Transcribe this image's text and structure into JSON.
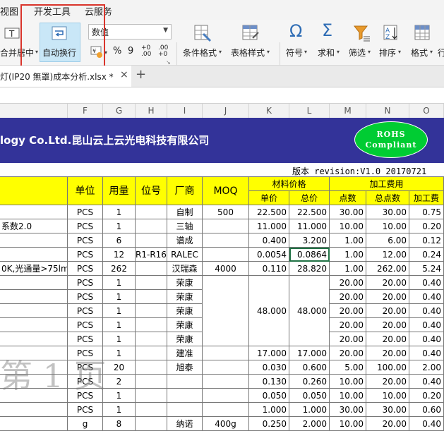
{
  "menubar": {
    "view": "视图",
    "developer": "开发工具",
    "cloud": "云服务"
  },
  "ribbon": {
    "merge_center": "合并居中",
    "wrap_text": "自动换行",
    "number_format": "数值",
    "percent": "%",
    "comma": "9",
    "inc_decimal": "+0 .00",
    "dec_decimal": ".00 +0",
    "conditional_format": "条件格式",
    "table_style": "表格样式",
    "symbol": "符号",
    "sum": "求和",
    "filter": "筛选",
    "sort": "排序",
    "format": "格式",
    "more": "行"
  },
  "tab": {
    "filename": "灯(IP20 無罩)成本分析.xlsx *",
    "close": "×",
    "add": "+"
  },
  "columns": [
    "F",
    "G",
    "H",
    "I",
    "J",
    "K",
    "L",
    "M",
    "N",
    "O"
  ],
  "banner": {
    "company": "logy Co.Ltd.昆山云上云光电科技有限公司",
    "rohs_line1": "ROHS",
    "rohs_line2": "Compliant"
  },
  "version": "版本 revision:V1.0 20170721",
  "headers": {
    "unit": "单位",
    "qty": "用量",
    "position": "位号",
    "maker": "厂商",
    "moq": "MOQ",
    "material_price": "材料价格",
    "unit_price": "单价",
    "total_price": "总价",
    "processing_fee": "加工费用",
    "points": "点数",
    "total_points": "总点数",
    "processing": "加工费"
  },
  "rows": [
    {
      "desc": "",
      "unit": "PCS",
      "qty": "1",
      "pos": "",
      "maker": "自制",
      "moq": "500",
      "up": "22.500",
      "tp": "22.500",
      "pts": "30.00",
      "tpts": "30.00",
      "fee": "0.75"
    },
    {
      "desc": "系数2.0",
      "unit": "PCS",
      "qty": "1",
      "pos": "",
      "maker": "三轴",
      "moq": "",
      "up": "11.000",
      "tp": "11.000",
      "pts": "10.00",
      "tpts": "10.00",
      "fee": "0.20"
    },
    {
      "desc": "",
      "unit": "PCS",
      "qty": "6",
      "pos": "",
      "maker": "谱成",
      "moq": "",
      "up": "0.400",
      "tp": "3.200",
      "pts": "1.00",
      "tpts": "6.00",
      "fee": "0.12"
    },
    {
      "desc": "",
      "unit": "PCS",
      "qty": "12",
      "pos": "R1-R16",
      "maker": "RALEC",
      "moq": "",
      "up": "0.0054",
      "tp": "0.0864",
      "pts": "1.00",
      "tpts": "12.00",
      "fee": "0.24"
    },
    {
      "desc": "0K,光通量>75lm",
      "unit": "PCS",
      "qty": "262",
      "pos": "",
      "maker": "汉瑞森",
      "moq": "4000",
      "up": "0.110",
      "tp": "28.820",
      "pts": "1.00",
      "tpts": "262.00",
      "fee": "5.24"
    },
    {
      "desc": "",
      "unit": "PCS",
      "qty": "1",
      "pos": "",
      "maker": "荣康",
      "moq": "",
      "up": "",
      "tp": "",
      "pts": "20.00",
      "tpts": "20.00",
      "fee": "0.40"
    },
    {
      "desc": "",
      "unit": "PCS",
      "qty": "1",
      "pos": "",
      "maker": "荣康",
      "moq": "",
      "up": "",
      "tp": "",
      "pts": "20.00",
      "tpts": "20.00",
      "fee": "0.40"
    },
    {
      "desc": "",
      "unit": "PCS",
      "qty": "1",
      "pos": "",
      "maker": "荣康",
      "moq": "",
      "up": "48.000",
      "tp": "48.000",
      "pts": "20.00",
      "tpts": "20.00",
      "fee": "0.40"
    },
    {
      "desc": "",
      "unit": "PCS",
      "qty": "1",
      "pos": "",
      "maker": "荣康",
      "moq": "",
      "up": "",
      "tp": "",
      "pts": "20.00",
      "tpts": "20.00",
      "fee": "0.40"
    },
    {
      "desc": "",
      "unit": "PCS",
      "qty": "1",
      "pos": "",
      "maker": "荣康",
      "moq": "",
      "up": "",
      "tp": "",
      "pts": "20.00",
      "tpts": "20.00",
      "fee": "0.40"
    },
    {
      "desc": "",
      "unit": "PCS",
      "qty": "1",
      "pos": "",
      "maker": "建准",
      "moq": "",
      "up": "17.000",
      "tp": "17.000",
      "pts": "20.00",
      "tpts": "20.00",
      "fee": "0.40"
    },
    {
      "desc": "",
      "unit": "PCS",
      "qty": "20",
      "pos": "",
      "maker": "旭泰",
      "moq": "",
      "up": "0.030",
      "tp": "0.600",
      "pts": "5.00",
      "tpts": "100.00",
      "fee": "2.00"
    },
    {
      "desc": "",
      "unit": "PCS",
      "qty": "2",
      "pos": "",
      "maker": "",
      "moq": "",
      "up": "0.130",
      "tp": "0.260",
      "pts": "10.00",
      "tpts": "20.00",
      "fee": "0.40"
    },
    {
      "desc": "",
      "unit": "PCS",
      "qty": "1",
      "pos": "",
      "maker": "",
      "moq": "",
      "up": "0.050",
      "tp": "0.050",
      "pts": "10.00",
      "tpts": "10.00",
      "fee": "0.20"
    },
    {
      "desc": "",
      "unit": "PCS",
      "qty": "1",
      "pos": "",
      "maker": "",
      "moq": "",
      "up": "1.000",
      "tp": "1.000",
      "pts": "30.00",
      "tpts": "30.00",
      "fee": "0.60"
    },
    {
      "desc": "",
      "unit": "g",
      "qty": "8",
      "pos": "",
      "maker": "纳诺",
      "moq": "400g",
      "up": "0.250",
      "tp": "2.000",
      "pts": "10.00",
      "tpts": "20.00",
      "fee": "0.40"
    }
  ],
  "watermark": "第 1 页",
  "colors": {
    "banner": "#333399",
    "header_yellow": "#ffff00",
    "rohs_green": "#00cc33",
    "highlight_red": "#d9342b",
    "selected_cell": "#217346"
  }
}
